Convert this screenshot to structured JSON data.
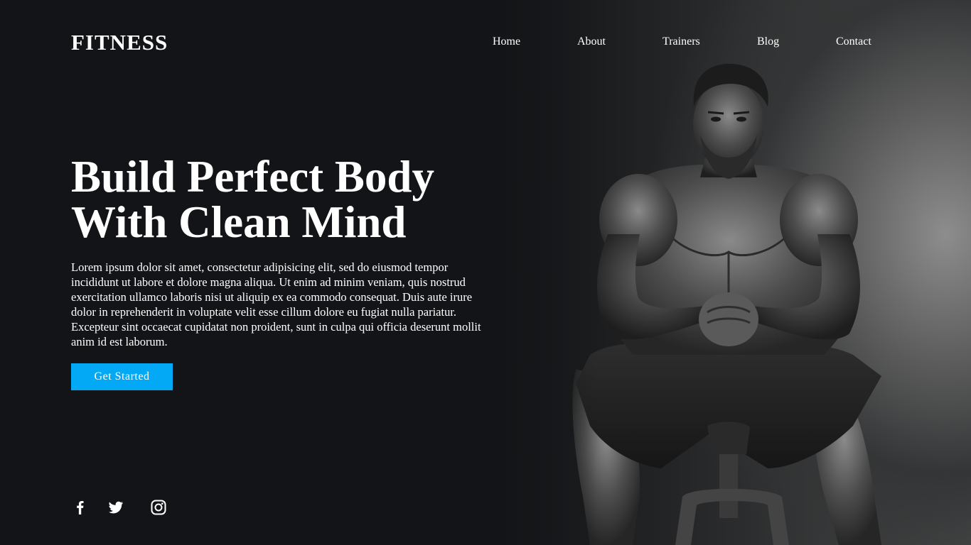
{
  "header": {
    "logo": "FITNESS",
    "nav": [
      {
        "label": "Home"
      },
      {
        "label": "About"
      },
      {
        "label": "Trainers"
      },
      {
        "label": "Blog"
      },
      {
        "label": "Contact"
      }
    ]
  },
  "hero": {
    "headline_line1": "Build Perfect Body",
    "headline_line2": "With Clean Mind",
    "body": "Lorem ipsum dolor sit amet, consectetur adipisicing elit, sed do eiusmod tempor incididunt ut labore et dolore magna aliqua. Ut enim ad minim veniam, quis nostrud exercitation ullamco laboris nisi ut aliquip ex ea commodo consequat. Duis aute irure dolor in reprehenderit in voluptate velit esse cillum dolore eu fugiat nulla pariatur. Excepteur sint occaecat cupidatat non proident, sunt in culpa qui officia deserunt mollit anim id est laborum.",
    "cta_label": "Get Started",
    "image_subject": "muscular man seated on exercise bike, black and white photo"
  },
  "social": [
    {
      "icon": "facebook-icon"
    },
    {
      "icon": "twitter-icon"
    },
    {
      "icon": "instagram-icon"
    }
  ],
  "colors": {
    "background": "#121417",
    "accent": "#03a9f4",
    "text": "#ffffff"
  }
}
